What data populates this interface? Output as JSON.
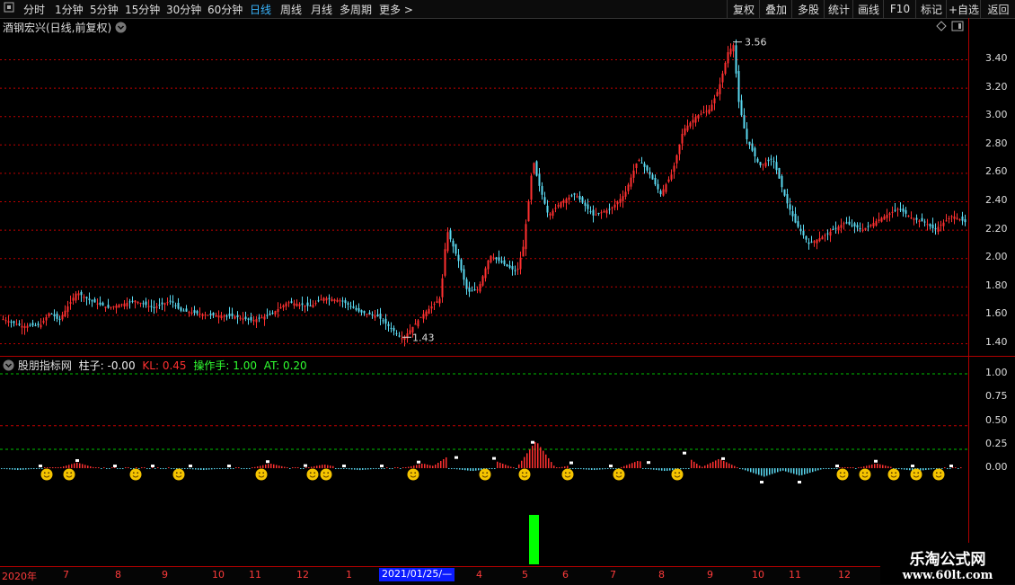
{
  "toolbar": {
    "left_items": [
      "分时",
      "1分钟",
      "5分钟",
      "15分钟",
      "30分钟",
      "60分钟",
      "日线",
      "周线",
      "月线",
      "多周期",
      "更多 >"
    ],
    "active": "日线",
    "right_items": [
      "复权",
      "叠加",
      "多股",
      "统计",
      "画线",
      "F10",
      "标记",
      "+自选",
      "返回"
    ]
  },
  "main_panel": {
    "title": "酒钢宏兴(日线,前复权)",
    "high_label": "3.56",
    "low_label": "1.43",
    "y_ticks": [
      "3.40",
      "3.20",
      "3.00",
      "2.80",
      "2.60",
      "2.40",
      "2.20",
      "2.00",
      "1.80",
      "1.60",
      "1.40"
    ]
  },
  "indicator_panel": {
    "name": "股朋指标网",
    "zhuzi_label": "柱子: -0.00",
    "kl_label": "KL: 0.45",
    "czs_label": "操作手: 1.00",
    "at_label": "AT: 0.20",
    "y_ticks": [
      "1.00",
      "0.75",
      "0.50",
      "0.25",
      "0.00"
    ]
  },
  "x_axis": {
    "labels": [
      "2020年",
      "7",
      "8",
      "9",
      "10",
      "11",
      "12",
      "1",
      "4",
      "5",
      "6",
      "7",
      "8",
      "9",
      "10",
      "11",
      "12"
    ],
    "selected_date": "2021/01/25/—"
  },
  "watermark": {
    "title": "乐淘公式网",
    "url": "www.60lt.com"
  },
  "colors": {
    "up": "#ff3030",
    "down": "#5ad8f0",
    "dashed_red": "#c00000",
    "dashed_green": "#00c000",
    "signal_bar": "#00ff00",
    "smiley": "#f5c400"
  }
}
